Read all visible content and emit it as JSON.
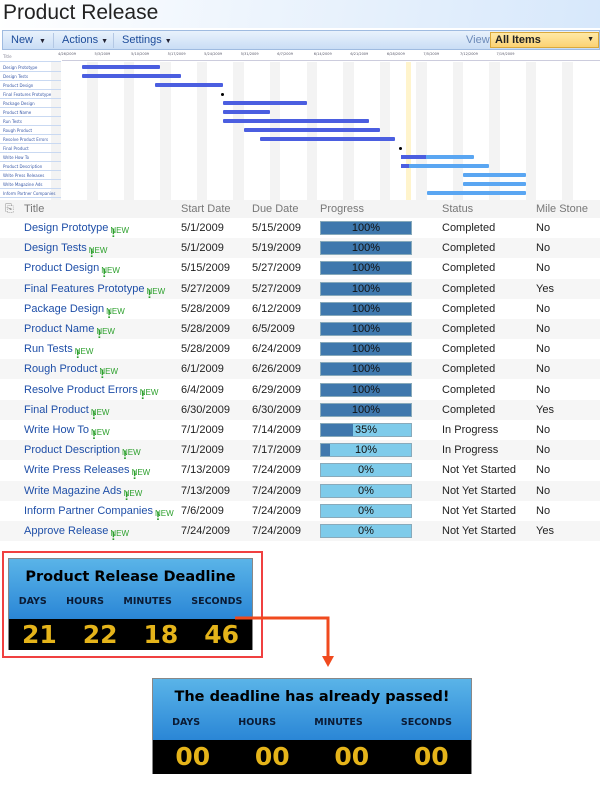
{
  "page_title": "Product Release",
  "toolbar": {
    "new": "New",
    "actions": "Actions",
    "settings": "Settings",
    "view_label": "View:",
    "view_value": "All Items"
  },
  "gantt": {
    "title_header": "Title",
    "weeks": [
      "4/26/2009",
      "5/3/2009",
      "5/10/2009",
      "5/17/2009",
      "5/24/2009",
      "5/31/2009",
      "6/7/2009",
      "6/14/2009",
      "6/21/2009",
      "6/28/2009",
      "7/5/2009",
      "7/12/2009",
      "7/19/2009"
    ],
    "today": "7/2/2009",
    "colors": {
      "complete": "#4b5ee0",
      "remaining": "#5aa6f2",
      "today": "#fff4cc"
    }
  },
  "table": {
    "headers": {
      "title": "Title",
      "start": "Start Date",
      "due": "Due Date",
      "progress": "Progress",
      "status": "Status",
      "milestone": "Mile Stone"
    },
    "new_badge": "NEW",
    "rows": [
      {
        "title": "Design Prototype",
        "start": "5/1/2009",
        "due": "5/15/2009",
        "progress": 100,
        "progress_label": "100%",
        "status": "Completed",
        "milestone": "No"
      },
      {
        "title": "Design Tests",
        "start": "5/1/2009",
        "due": "5/19/2009",
        "progress": 100,
        "progress_label": "100%",
        "status": "Completed",
        "milestone": "No"
      },
      {
        "title": "Product Design",
        "start": "5/15/2009",
        "due": "5/27/2009",
        "progress": 100,
        "progress_label": "100%",
        "status": "Completed",
        "milestone": "No"
      },
      {
        "title": "Final Features Prototype",
        "start": "5/27/2009",
        "due": "5/27/2009",
        "progress": 100,
        "progress_label": "100%",
        "status": "Completed",
        "milestone": "Yes"
      },
      {
        "title": "Package Design",
        "start": "5/28/2009",
        "due": "6/12/2009",
        "progress": 100,
        "progress_label": "100%",
        "status": "Completed",
        "milestone": "No"
      },
      {
        "title": "Product Name",
        "start": "5/28/2009",
        "due": "6/5/2009",
        "progress": 100,
        "progress_label": "100%",
        "status": "Completed",
        "milestone": "No"
      },
      {
        "title": "Run Tests",
        "start": "5/28/2009",
        "due": "6/24/2009",
        "progress": 100,
        "progress_label": "100%",
        "status": "Completed",
        "milestone": "No"
      },
      {
        "title": "Rough Product",
        "start": "6/1/2009",
        "due": "6/26/2009",
        "progress": 100,
        "progress_label": "100%",
        "status": "Completed",
        "milestone": "No"
      },
      {
        "title": "Resolve Product Errors",
        "start": "6/4/2009",
        "due": "6/29/2009",
        "progress": 100,
        "progress_label": "100%",
        "status": "Completed",
        "milestone": "No"
      },
      {
        "title": "Final Product",
        "start": "6/30/2009",
        "due": "6/30/2009",
        "progress": 100,
        "progress_label": "100%",
        "status": "Completed",
        "milestone": "Yes"
      },
      {
        "title": "Write How To",
        "start": "7/1/2009",
        "due": "7/14/2009",
        "progress": 35,
        "progress_label": "35%",
        "status": "In Progress",
        "milestone": "No"
      },
      {
        "title": "Product Description",
        "start": "7/1/2009",
        "due": "7/17/2009",
        "progress": 10,
        "progress_label": "10%",
        "status": "In Progress",
        "milestone": "No"
      },
      {
        "title": "Write Press Releases",
        "start": "7/13/2009",
        "due": "7/24/2009",
        "progress": 0,
        "progress_label": "0%",
        "status": "Not Yet Started",
        "milestone": "No"
      },
      {
        "title": "Write Magazine Ads",
        "start": "7/13/2009",
        "due": "7/24/2009",
        "progress": 0,
        "progress_label": "0%",
        "status": "Not Yet Started",
        "milestone": "No"
      },
      {
        "title": "Inform Partner Companies",
        "start": "7/6/2009",
        "due": "7/24/2009",
        "progress": 0,
        "progress_label": "0%",
        "status": "Not Yet Started",
        "milestone": "No"
      },
      {
        "title": "Approve Release",
        "start": "7/24/2009",
        "due": "7/24/2009",
        "progress": 0,
        "progress_label": "0%",
        "status": "Not Yet Started",
        "milestone": "Yes"
      }
    ]
  },
  "countdown1": {
    "title": "Product Release Deadline",
    "labels": [
      "DAYS",
      "HOURS",
      "MINUTES",
      "SECONDS"
    ],
    "values": [
      "21",
      "22",
      "18",
      "46"
    ]
  },
  "countdown2": {
    "title": "The deadline has already passed!",
    "labels": [
      "DAYS",
      "HOURS",
      "MINUTES",
      "SECONDS"
    ],
    "values": [
      "00",
      "00",
      "00",
      "00"
    ]
  }
}
